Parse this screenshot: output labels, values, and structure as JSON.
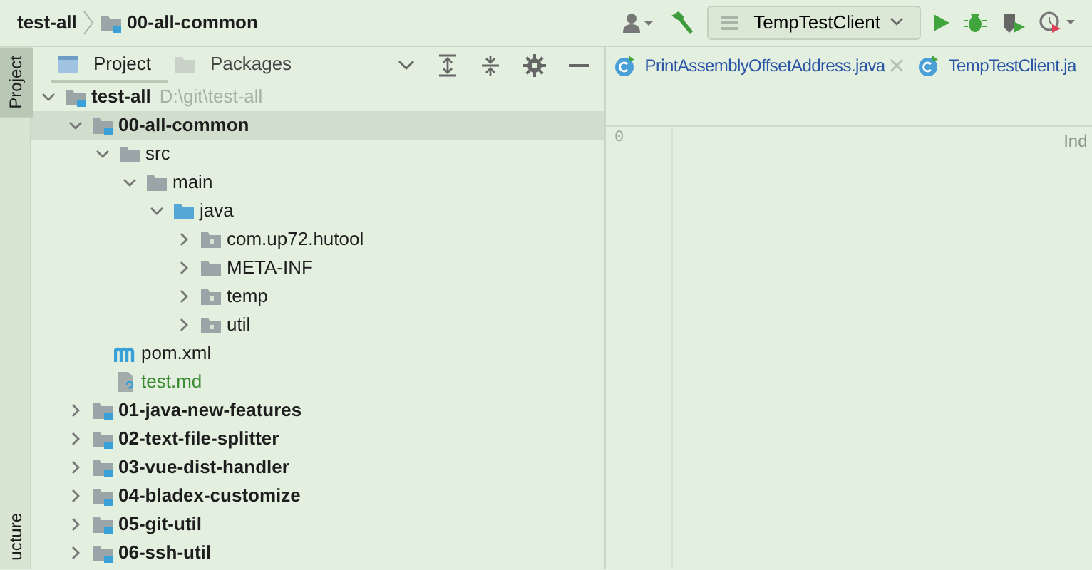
{
  "breadcrumb": [
    {
      "label": "test-all",
      "kind": "project"
    },
    {
      "label": "00-all-common",
      "kind": "module"
    }
  ],
  "run_config": {
    "label": "TempTestClient"
  },
  "side_tabs": [
    {
      "label": "Project",
      "selected": true
    },
    {
      "label": "ucture",
      "selected": false
    }
  ],
  "panel_tabs": [
    {
      "label": "Project",
      "selected": true
    },
    {
      "label": "Packages",
      "selected": false
    }
  ],
  "tree": [
    {
      "label": "test-all",
      "kind": "module",
      "hint": "D:\\git\\test-all",
      "expanded": true,
      "selected": false,
      "children": [
        {
          "label": "00-all-common",
          "kind": "module",
          "expanded": true,
          "selected": true,
          "children": [
            {
              "label": "src",
              "kind": "folder",
              "expanded": true,
              "selected": false,
              "children": [
                {
                  "label": "main",
                  "kind": "folder",
                  "expanded": true,
                  "selected": false,
                  "children": [
                    {
                      "label": "java",
                      "kind": "source",
                      "expanded": true,
                      "selected": false,
                      "children": [
                        {
                          "label": "com.up72.hutool",
                          "kind": "package",
                          "expanded": false,
                          "selected": false
                        },
                        {
                          "label": "META-INF",
                          "kind": "folder",
                          "expanded": false,
                          "selected": false
                        },
                        {
                          "label": "temp",
                          "kind": "package",
                          "expanded": false,
                          "selected": false
                        },
                        {
                          "label": "util",
                          "kind": "package",
                          "expanded": false,
                          "selected": false
                        }
                      ]
                    }
                  ]
                }
              ]
            },
            {
              "label": "pom.xml",
              "kind": "maven",
              "selected": false
            },
            {
              "label": "test.md",
              "kind": "markdown",
              "selected": false
            }
          ]
        },
        {
          "label": "01-java-new-features",
          "kind": "module",
          "expanded": false,
          "selected": false
        },
        {
          "label": "02-text-file-splitter",
          "kind": "module",
          "expanded": false,
          "selected": false
        },
        {
          "label": "03-vue-dist-handler",
          "kind": "module",
          "expanded": false,
          "selected": false
        },
        {
          "label": "04-bladex-customize",
          "kind": "module",
          "expanded": false,
          "selected": false
        },
        {
          "label": "05-git-util",
          "kind": "module",
          "expanded": false,
          "selected": false
        },
        {
          "label": "06-ssh-util",
          "kind": "module",
          "expanded": false,
          "selected": false
        }
      ]
    }
  ],
  "editor_tabs": [
    {
      "label": "PrintAssemblyOffsetAddress.java",
      "closable": true,
      "selected": false
    },
    {
      "label": "TempTestClient.ja",
      "closable": false,
      "selected": false
    }
  ],
  "editor": {
    "line_number": "0",
    "status": "Ind"
  }
}
